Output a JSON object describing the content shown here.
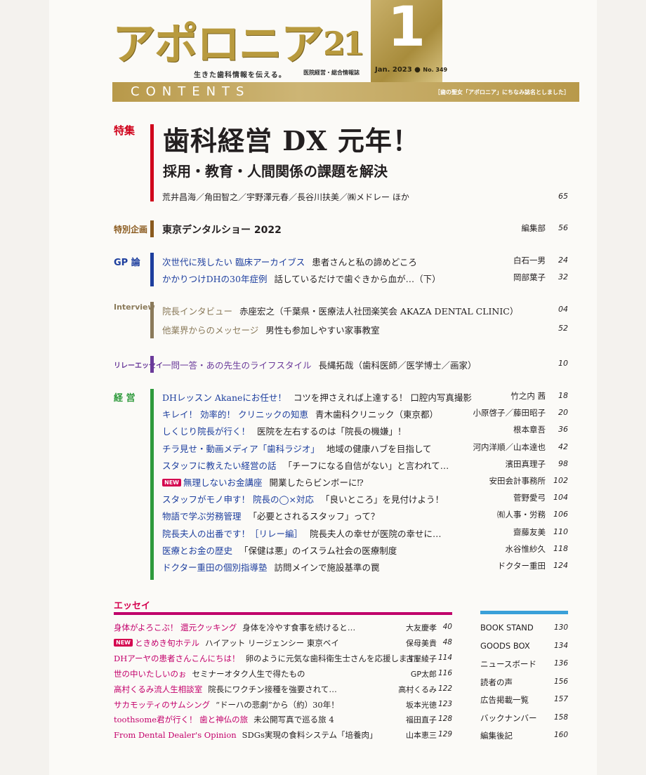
{
  "header": {
    "logo": "アポロニア",
    "logo_num": "21",
    "tagline": "生きた歯科情報を伝える。",
    "genre": "医院経営・総合情報誌",
    "issue_number": "1",
    "issue_date": "Jan. 2023 ●",
    "issue_no": "No. 349",
    "contents_word": "CONTENTS",
    "contents_note": "［歯の聖女「アポロニア」にちなみ誌名としました］"
  },
  "colors": {
    "gold": "#b8994a",
    "red": "#d0021b",
    "brown": "#8a5a1e",
    "blue": "#1d3e9e",
    "taupe": "#8a7a5a",
    "purple": "#6a3a9a",
    "green": "#2e9a3c",
    "magenta": "#c3006b",
    "sky": "#3aa0d8"
  },
  "feature": {
    "label": "特集",
    "title": "歯科経営 DX 元年！",
    "subtitle": "採用・教育・人間関係の課題を解決",
    "authors": "荒井昌海／角田智之／宇野澤元春／長谷川扶美／㈱メドレー ほか",
    "page": "65"
  },
  "special": {
    "label": "特別企画",
    "title": "東京デンタルショー 2022",
    "author": "編集部",
    "page": "56"
  },
  "gp": {
    "label": "GP 論",
    "items": [
      {
        "title": "次世代に残したい 臨床アーカイブス",
        "sub": "患者さんと私の諦めどころ",
        "author": "白石一男",
        "page": "24"
      },
      {
        "title": "かかりつけDHの30年症例",
        "sub": "話しているだけで歯ぐきから血が…（下）",
        "author": "岡部葉子",
        "page": "32"
      }
    ]
  },
  "interview": {
    "label": "Interview",
    "items": [
      {
        "title": "院長インタビュー",
        "sub": "赤座宏之（千葉県・医療法人社団楽笑会 AKAZA DENTAL CLINIC）",
        "author": "",
        "page": "04"
      },
      {
        "title": "他業界からのメッセージ",
        "sub": "男性も参加しやすい家事教室",
        "author": "",
        "page": "52"
      }
    ]
  },
  "relay": {
    "label": "リレーエッセイ",
    "items": [
      {
        "title": "一問一答・あの先生のライフスタイル",
        "sub": "長縄拓哉（歯科医師／医学博士／画家）",
        "author": "",
        "page": "10"
      }
    ]
  },
  "management": {
    "label": "経 営",
    "items": [
      {
        "new": "",
        "title": "DHレッスン Akaneにお任せ！",
        "sub": "コツを押さえれば上達する！ 口腔内写真撮影",
        "author": "竹之内 茜",
        "page": "18"
      },
      {
        "new": "",
        "title": "キレイ！ 効率的！ クリニックの知恵",
        "sub": "青木歯科クリニック（東京都）",
        "author": "小原啓子／藤田昭子",
        "page": "20"
      },
      {
        "new": "",
        "title": "しくじり院長が行く！",
        "sub": "医院を左右するのは「院長の機嫌」！",
        "author": "根本章吾",
        "page": "36"
      },
      {
        "new": "",
        "title": "チラ見せ・動画メディア「歯科ラジオ」",
        "sub": "地域の健康ハブを目指して",
        "author": "河内洋順／山本達也",
        "page": "42"
      },
      {
        "new": "",
        "title": "スタッフに教えたい経営の話",
        "sub": "「チーフになる自信がない」と言われて…",
        "author": "濱田真理子",
        "page": "98"
      },
      {
        "new": "NEW",
        "title": "無理しないお金講座",
        "sub": "開業したらビンボーに⁉",
        "author": "安田会計事務所",
        "page": "102"
      },
      {
        "new": "",
        "title": "スタッフがモノ申す！ 院長の◯×対応",
        "sub": "「良いところ」を見付けよう！",
        "author": "菅野愛弓",
        "page": "104"
      },
      {
        "new": "",
        "title": "物語で学ぶ労務管理",
        "sub": "「必要とされるスタッフ」って？",
        "author": "㈲人事・労務",
        "page": "106"
      },
      {
        "new": "",
        "title": "院長夫人の出番です！［リレー編］",
        "sub": "院長夫人の幸せが医院の幸せに…",
        "author": "齋藤友美",
        "page": "110"
      },
      {
        "new": "",
        "title": "医療とお金の歴史",
        "sub": "「保健は悪」のイスラム社会の医療制度",
        "author": "水谷惟紗久",
        "page": "118"
      },
      {
        "new": "",
        "title": "ドクター重田の個別指導塾",
        "sub": "訪問メインで施設基準の罠",
        "author": "ドクター重田",
        "page": "124"
      }
    ]
  },
  "essay": {
    "label": "エッセイ",
    "items": [
      {
        "new": "",
        "title": "身体がよろこぶ！ 還元クッキング",
        "sub": "身体を冷やす食事を続けると…",
        "author": "大友慶孝",
        "page": "40"
      },
      {
        "new": "NEW",
        "title": "ときめき旬ホテル",
        "sub": "ハイアット リージェンシー 東京ベイ",
        "author": "保母美貴",
        "page": "48"
      },
      {
        "new": "",
        "title": "DHアーヤの患者さんこんにちは！",
        "sub": "卵のように元気な歯科衛生士さんを応援します！",
        "author": "古屋綾子",
        "page": "114"
      },
      {
        "new": "",
        "title": "世の中いたしいのぉ",
        "sub": "セミナーオタク人生で得たもの",
        "author": "GP太郎",
        "page": "116"
      },
      {
        "new": "",
        "title": "高村くるみ流人生相談室",
        "sub": "院長にワクチン接種を強要されて…",
        "author": "高村くるみ",
        "page": "122"
      },
      {
        "new": "",
        "title": "サカモッティのサムシング",
        "sub": "“ドーハの悲劇”から（約）30年！",
        "author": "坂本光徳",
        "page": "123"
      },
      {
        "new": "",
        "title": "toothsome君が行く！ 歯と神仏の旅",
        "sub": "未公開写真で巡る旅 4",
        "author": "福田直子",
        "page": "128"
      },
      {
        "new": "",
        "title": "From Dental Dealer's Opinion",
        "sub": "SDGs実現の食料システム「培養肉」",
        "author": "山本恵三",
        "page": "129"
      }
    ]
  },
  "sidebar": {
    "items": [
      {
        "title": "BOOK STAND",
        "page": "130"
      },
      {
        "title": "GOODS BOX",
        "page": "134"
      },
      {
        "title": "ニュースボード",
        "page": "136"
      },
      {
        "title": "読者の声",
        "page": "156"
      },
      {
        "title": "広告掲載一覧",
        "page": "157"
      },
      {
        "title": "バックナンバー",
        "page": "158"
      },
      {
        "title": "編集後記",
        "page": "160"
      }
    ]
  }
}
